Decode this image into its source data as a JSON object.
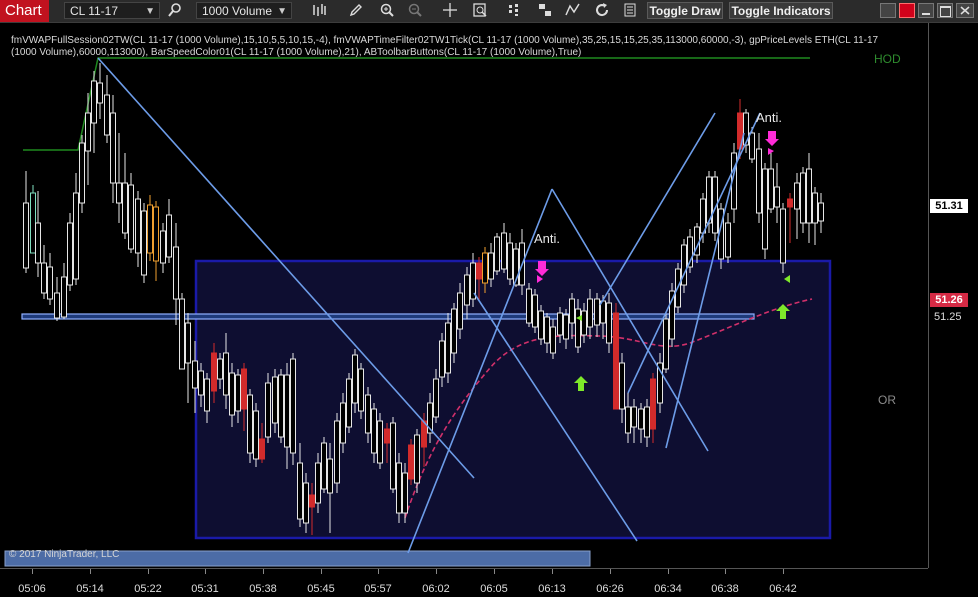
{
  "toolbar": {
    "chart_tab": "Chart",
    "instrument": "CL 11-17",
    "interval": "1000 Volume",
    "toggle_draw": "Toggle Draw",
    "toggle_indicators": "Toggle Indicators",
    "icons": [
      "search-icon",
      "bar-style-icon",
      "pencil-icon",
      "zoom-in-icon",
      "zoom-out-icon",
      "crosshair-icon",
      "data-box-icon",
      "strategy-icon",
      "template-icon",
      "indicator-icon",
      "refresh-icon",
      "properties-icon"
    ]
  },
  "indicators": {
    "line1": "fmVWAPFullSession02TW(CL 11-17 (1000 Volume),15,10,5,5,10,15,-4), fmVWAPTimeFilter02TW1Tick(CL 11-17 (1000 Volume),35,25,15,15,25,35,113000,60000,-3), gpPriceLevels ETH(CL 11-17",
    "line2": "(1000 Volume),60000,113000), BarSpeedColor01(CL 11-17 (1000 Volume),21), ABToolbarButtons(CL 11-17 (1000 Volume),True)"
  },
  "labels": {
    "hod": "HOD",
    "or": "OR",
    "anti_1": "Anti.",
    "anti_2": "Anti.",
    "copyright": "© 2017 NinjaTrader, LLC"
  },
  "price_axis": {
    "last_price": "51.31",
    "vwap_price": "51.26",
    "tick_label": "51.25"
  },
  "time_axis": [
    "05:06",
    "05:14",
    "05:22",
    "05:31",
    "05:38",
    "05:45",
    "05:57",
    "06:02",
    "06:05",
    "06:13",
    "06:26",
    "06:34",
    "06:38",
    "06:42"
  ],
  "colors": {
    "up_candle": "#e6e6e6",
    "down_candle": "#d22b2b",
    "slow_up": "#f0a030",
    "cyan_candle": "#7fe0c0",
    "trendline": "#6d9ce8",
    "or_box": "#1a1aa8",
    "hod_line": "#1f8a1f",
    "vwap": "#d0306a",
    "magenta_arrow": "#ff2bd8",
    "green_arrow": "#7ee82a",
    "last_price_box": "#ffffff",
    "vwap_box": "#d62a45"
  }
}
